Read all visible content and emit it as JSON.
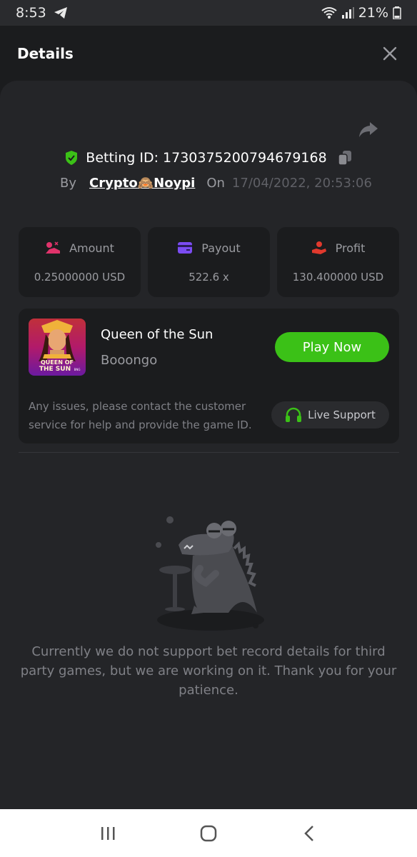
{
  "status_bar": {
    "time": "8:53",
    "battery": "21%"
  },
  "header": {
    "title": "Details"
  },
  "bet": {
    "id_text": "Betting ID: 1730375200794679168",
    "by_label": "By",
    "user_prefix": "Crypto",
    "user_emoji": "🙈",
    "user_suffix": "Noypi",
    "on_label": "On",
    "datetime": "17/04/2022, 20:53:06"
  },
  "stats": [
    {
      "label": "Amount",
      "value": "0.25000000 USD",
      "icon": "amount-icon",
      "color": "#e0336b"
    },
    {
      "label": "Payout",
      "value": "522.6 x",
      "icon": "payout-card-icon",
      "color": "#7b4cf2"
    },
    {
      "label": "Profit",
      "value": "130.400000 USD",
      "icon": "profit-hand-icon",
      "color": "#e0392d"
    }
  ],
  "game": {
    "name": "Queen of the Sun",
    "provider": "Booongo",
    "thumb_line1": "QUEEN OF",
    "thumb_line2": "THE SUN",
    "thumb_badge": "BNG",
    "play_label": "Play Now",
    "issue_text": "Any issues, please contact the customer service for help and provide the game ID.",
    "support_label": "Live Support"
  },
  "empty": {
    "message": "Currently we do not support bet record details for third party games, but we are working on it. Thank you for your patience."
  },
  "colors": {
    "accent": "#3bc117",
    "background": "#1b1c1e",
    "sheet": "#242528"
  }
}
